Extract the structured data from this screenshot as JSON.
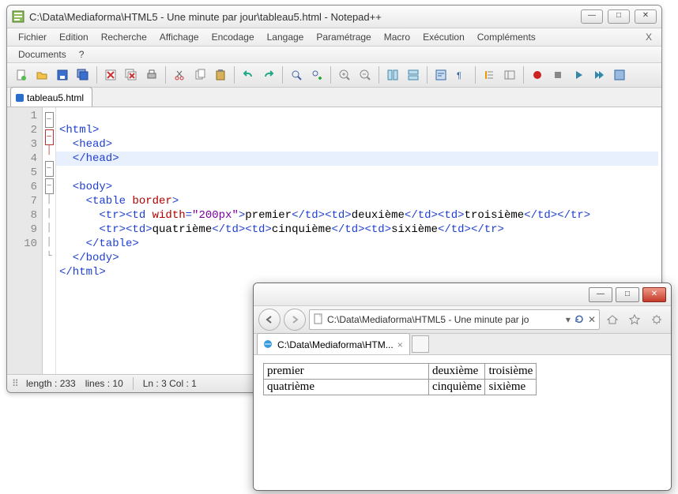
{
  "npp": {
    "title": "C:\\Data\\Mediaforma\\HTML5 - Une minute par jour\\tableau5.html - Notepad++",
    "menu": [
      "Fichier",
      "Edition",
      "Recherche",
      "Affichage",
      "Encodage",
      "Langage",
      "Paramétrage",
      "Macro",
      "Exécution",
      "Compléments"
    ],
    "menu2": [
      "Documents",
      "?"
    ],
    "menu_close_x": "X",
    "tab_label": "tableau5.html",
    "status_length": "length : 233",
    "status_lines": "lines : 10",
    "status_pos": "Ln : 3    Col : 1",
    "line_numbers": [
      "1",
      "2",
      "3",
      "4",
      "5",
      "6",
      "7",
      "8",
      "9",
      "10"
    ],
    "code": {
      "l1": {
        "a": "<html>"
      },
      "l2": {
        "a": "  <head>"
      },
      "l3": {
        "a": "  </head>"
      },
      "l4": {
        "a": "  <body>"
      },
      "l5": {
        "a": "    <table ",
        "attr": "border",
        "b": ">"
      },
      "l6": {
        "a": "      <tr><td ",
        "attr": "width",
        "eq": "=",
        "val": "\"200px\"",
        "b": ">",
        "t1": "premier",
        "c": "</td><td>",
        "t2": "deuxième",
        "d": "</td><td>",
        "t3": "troisième",
        "e": "</td></tr>"
      },
      "l7": {
        "a": "      <tr><td>",
        "t1": "quatrième",
        "b": "</td><td>",
        "t2": "cinquième",
        "c": "</td><td>",
        "t3": "sixième",
        "d": "</td></tr>"
      },
      "l8": {
        "a": "    </table>"
      },
      "l9": {
        "a": "  </body>"
      },
      "l10": {
        "a": "</html>"
      }
    }
  },
  "ie": {
    "address": "C:\\Data\\Mediaforma\\HTML5 - Une minute par jo",
    "tab_label": "C:\\Data\\Mediaforma\\HTM...",
    "table": {
      "r1c1": "premier",
      "r1c2": "deuxième",
      "r1c3": "troisième",
      "r2c1": "quatrième",
      "r2c2": "cinquième",
      "r2c3": "sixième"
    }
  }
}
